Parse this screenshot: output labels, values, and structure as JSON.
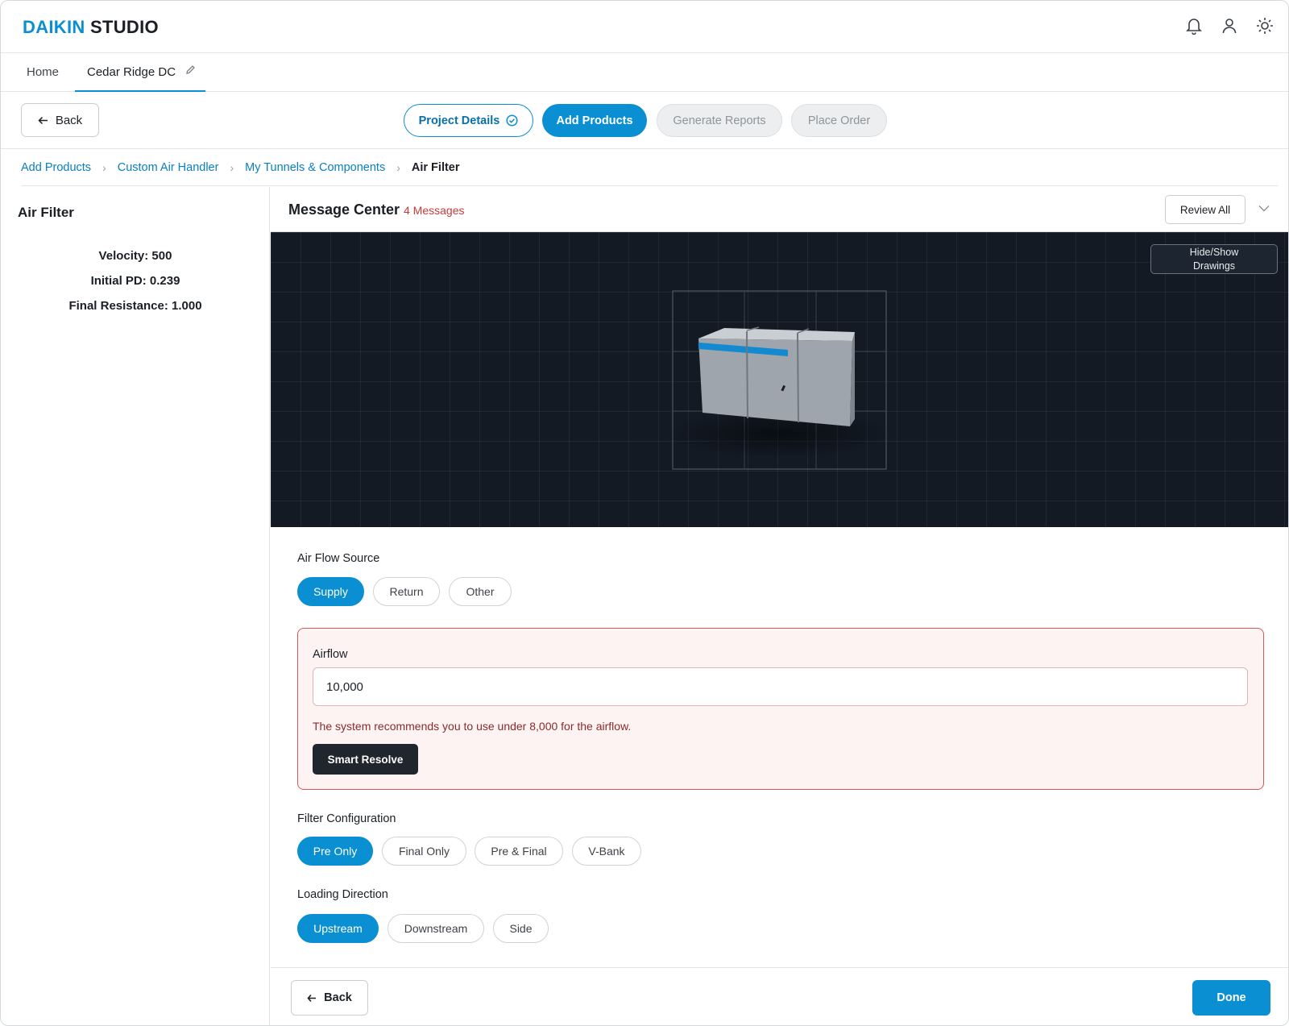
{
  "brand": {
    "part1": "DAIKIN",
    "part2": "STUDIO"
  },
  "header_icons": [
    "bell-icon",
    "user-icon",
    "sun-icon"
  ],
  "tabs": {
    "home": "Home",
    "project": "Cedar Ridge DC"
  },
  "toolbar": {
    "back_label": "Back"
  },
  "steps": [
    {
      "label": "Project Details",
      "state": "completed"
    },
    {
      "label": "Add Products",
      "state": "active"
    },
    {
      "label": "Generate Reports",
      "state": "disabled"
    },
    {
      "label": "Place Order",
      "state": "disabled"
    }
  ],
  "breadcrumb": [
    "Add Products",
    "Custom Air Handler",
    "My Tunnels & Components",
    "Air Filter"
  ],
  "left_panel": {
    "title": "Air Filter",
    "stats": [
      "Velocity: 500",
      "Initial PD: 0.239",
      "Final Resistance: 1.000"
    ]
  },
  "message_center": {
    "title": "Message Center",
    "count": "4 Messages",
    "review_label": "Review All"
  },
  "viewport": {
    "toggle_line1": "Hide/Show",
    "toggle_line2": "Drawings"
  },
  "form": {
    "air_flow_source": {
      "label": "Air Flow Source",
      "options": [
        "Supply",
        "Return",
        "Other"
      ],
      "selected": "Supply"
    },
    "airflow": {
      "label": "Airflow",
      "value": "10,000",
      "error": "The system recommends you to use under 8,000 for the airflow.",
      "resolve_label": "Smart Resolve"
    },
    "filter_configuration": {
      "label": "Filter Configuration",
      "options": [
        "Pre Only",
        "Final Only",
        "Pre & Final",
        "V-Bank"
      ],
      "selected": "Pre Only"
    },
    "loading_direction": {
      "label": "Loading Direction",
      "options": [
        "Upstream",
        "Downstream",
        "Side"
      ],
      "selected": "Upstream"
    }
  },
  "footer": {
    "back_label": "Back",
    "done_label": "Done"
  },
  "colors": {
    "accent": "#0a8fd2",
    "error": "#d9575c",
    "dark": "#20262d"
  }
}
